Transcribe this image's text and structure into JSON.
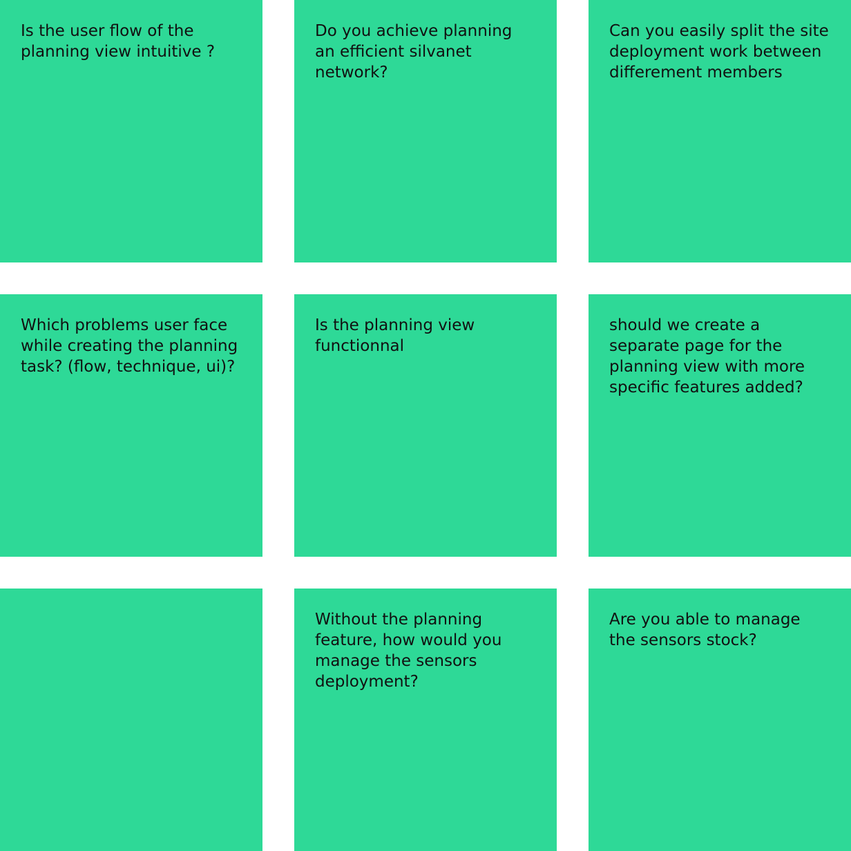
{
  "theme": {
    "note_color": "#2ed997",
    "text_color": "#111111",
    "background": "#ffffff"
  },
  "notes": [
    {
      "text": "Is the user flow of the planning view intuitive ?"
    },
    {
      "text": "Do you achieve planning an efficient silvanet network?"
    },
    {
      "text": "Can you easily split the site deployment work between differement members"
    },
    {
      "text": "Which problems user face while creating the planning task? (flow, technique, ui)?"
    },
    {
      "text": "Is the planning view functionnal"
    },
    {
      "text": "should we create a separate page for the planning view with more specific features added?"
    },
    {
      "text": ""
    },
    {
      "text": "Without the planning feature, how would you manage the sensors deployment?"
    },
    {
      "text": "Are you able to manage the sensors stock?"
    }
  ]
}
